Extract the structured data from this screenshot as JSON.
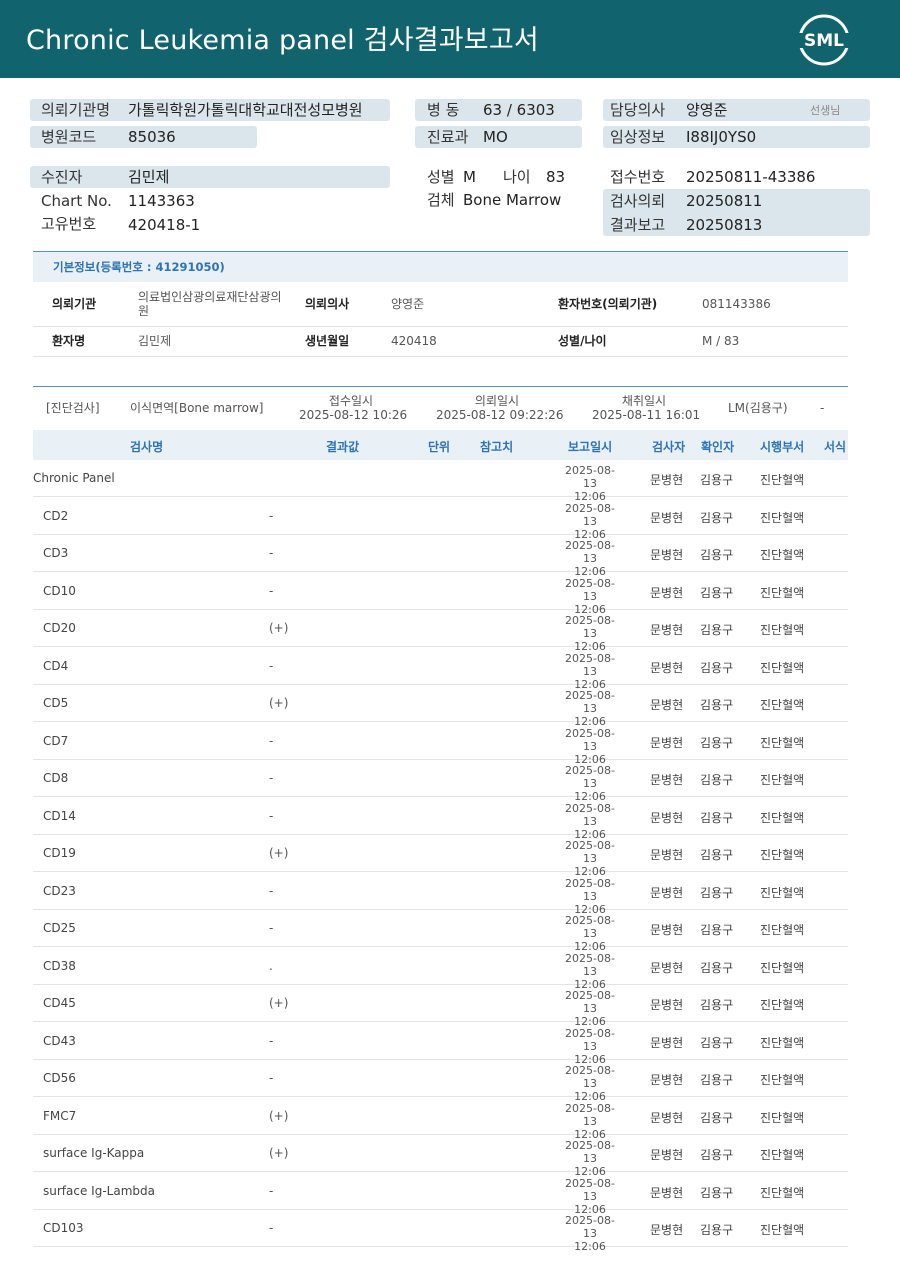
{
  "header": {
    "title": "Chronic  Leukemia  panel 검사결과보고서",
    "logo_text": "SML",
    "brand_color": "#11636d"
  },
  "patient": {
    "institution_label": "의뢰기관명",
    "institution_value": "가톨릭학원가톨릭대학교대전성모병원",
    "hospital_code_label": "병원코드",
    "hospital_code_value": "85036",
    "ward_label": "병  동",
    "ward_value": "63 / 6303",
    "dept_label": "진료과",
    "dept_value": "MO",
    "doctor_label": "담당의사",
    "doctor_value": "양영준",
    "doctor_suffix": "선생님",
    "clinical_label": "임상정보",
    "clinical_value": "I88IJ0YS0",
    "patient_label": "수진자",
    "patient_value": "김민제",
    "chart_label": "Chart No.",
    "chart_value": "1143363",
    "unique_label": "고유번호",
    "unique_value": "420418-1",
    "sex_label": "성별",
    "sex_value": "M",
    "age_label": "나이",
    "age_value": "83",
    "specimen_label": "검체",
    "specimen_value": "Bone Marrow",
    "receipt_label": "접수번호",
    "receipt_value": "20250811-43386",
    "request_label": "검사의뢰",
    "request_value": "20250811",
    "report_label": "결과보고",
    "report_value": "20250813"
  },
  "basic": {
    "heading": "기본정보(등록번호 : 41291050)",
    "inst_label": "의뢰기관",
    "inst_value_1": "의료법인삼광의료재단삼광의",
    "inst_value_2": "원",
    "doctor_label": "의뢰의사",
    "doctor_value": "양영준",
    "pid_label": "환자번호(의뢰기관)",
    "pid_value": "081143386",
    "name_label": "환자명",
    "name_value": "김민제",
    "dob_label": "생년월일",
    "dob_value": "420418",
    "sexage_label": "성별/나이",
    "sexage_value": "M / 83"
  },
  "test": {
    "category": "[진단검사]",
    "specimen": "이식면역[Bone marrow]",
    "receipt_label": "접수일시",
    "receipt_value": "2025-08-12 10:26",
    "request_label": "의뢰일시",
    "request_value": "2025-08-12 09:22:26",
    "collect_label": "채취일시",
    "collect_value": "2025-08-11 16:01",
    "lm": "LM(김용구)",
    "dash": "-",
    "columns": [
      "검사명",
      "결과값",
      "단위",
      "참고치",
      "보고일시",
      "검사자",
      "확인자",
      "시행부서",
      "서식"
    ],
    "rows": [
      {
        "name": "Chronic Panel",
        "result": "",
        "date": "2025-08-13",
        "time": "12:06",
        "tester": "문병현",
        "confirmer": "김용구",
        "dept": "진단혈액",
        "indent": false
      },
      {
        "name": "CD2",
        "result": "-",
        "date": "2025-08-13",
        "time": "12:06",
        "tester": "문병현",
        "confirmer": "김용구",
        "dept": "진단혈액",
        "indent": true
      },
      {
        "name": "CD3",
        "result": "-",
        "date": "2025-08-13",
        "time": "12:06",
        "tester": "문병현",
        "confirmer": "김용구",
        "dept": "진단혈액",
        "indent": true
      },
      {
        "name": "CD10",
        "result": "-",
        "date": "2025-08-13",
        "time": "12:06",
        "tester": "문병현",
        "confirmer": "김용구",
        "dept": "진단혈액",
        "indent": true
      },
      {
        "name": "CD20",
        "result": "(+)",
        "date": "2025-08-13",
        "time": "12:06",
        "tester": "문병현",
        "confirmer": "김용구",
        "dept": "진단혈액",
        "indent": true
      },
      {
        "name": "CD4",
        "result": "-",
        "date": "2025-08-13",
        "time": "12:06",
        "tester": "문병현",
        "confirmer": "김용구",
        "dept": "진단혈액",
        "indent": true
      },
      {
        "name": "CD5",
        "result": "(+)",
        "date": "2025-08-13",
        "time": "12:06",
        "tester": "문병현",
        "confirmer": "김용구",
        "dept": "진단혈액",
        "indent": true
      },
      {
        "name": "CD7",
        "result": "-",
        "date": "2025-08-13",
        "time": "12:06",
        "tester": "문병현",
        "confirmer": "김용구",
        "dept": "진단혈액",
        "indent": true
      },
      {
        "name": "CD8",
        "result": "-",
        "date": "2025-08-13",
        "time": "12:06",
        "tester": "문병현",
        "confirmer": "김용구",
        "dept": "진단혈액",
        "indent": true
      },
      {
        "name": "CD14",
        "result": "-",
        "date": "2025-08-13",
        "time": "12:06",
        "tester": "문병현",
        "confirmer": "김용구",
        "dept": "진단혈액",
        "indent": true
      },
      {
        "name": "CD19",
        "result": "(+)",
        "date": "2025-08-13",
        "time": "12:06",
        "tester": "문병현",
        "confirmer": "김용구",
        "dept": "진단혈액",
        "indent": true
      },
      {
        "name": "CD23",
        "result": "-",
        "date": "2025-08-13",
        "time": "12:06",
        "tester": "문병현",
        "confirmer": "김용구",
        "dept": "진단혈액",
        "indent": true
      },
      {
        "name": "CD25",
        "result": "-",
        "date": "2025-08-13",
        "time": "12:06",
        "tester": "문병현",
        "confirmer": "김용구",
        "dept": "진단혈액",
        "indent": true
      },
      {
        "name": "CD38",
        "result": ".",
        "date": "2025-08-13",
        "time": "12:06",
        "tester": "문병현",
        "confirmer": "김용구",
        "dept": "진단혈액",
        "indent": true
      },
      {
        "name": "CD45",
        "result": "(+)",
        "date": "2025-08-13",
        "time": "12:06",
        "tester": "문병현",
        "confirmer": "김용구",
        "dept": "진단혈액",
        "indent": true
      },
      {
        "name": "CD43",
        "result": "-",
        "date": "2025-08-13",
        "time": "12:06",
        "tester": "문병현",
        "confirmer": "김용구",
        "dept": "진단혈액",
        "indent": true
      },
      {
        "name": "CD56",
        "result": "-",
        "date": "2025-08-13",
        "time": "12:06",
        "tester": "문병현",
        "confirmer": "김용구",
        "dept": "진단혈액",
        "indent": true
      },
      {
        "name": "FMC7",
        "result": "(+)",
        "date": "2025-08-13",
        "time": "12:06",
        "tester": "문병현",
        "confirmer": "김용구",
        "dept": "진단혈액",
        "indent": true
      },
      {
        "name": "surface Ig-Kappa",
        "result": "(+)",
        "date": "2025-08-13",
        "time": "12:06",
        "tester": "문병현",
        "confirmer": "김용구",
        "dept": "진단혈액",
        "indent": true
      },
      {
        "name": "surface Ig-Lambda",
        "result": "-",
        "date": "2025-08-13",
        "time": "12:06",
        "tester": "문병현",
        "confirmer": "김용구",
        "dept": "진단혈액",
        "indent": true
      },
      {
        "name": "CD103",
        "result": "-",
        "date": "2025-08-13",
        "time": "12:06",
        "tester": "문병현",
        "confirmer": "김용구",
        "dept": "진단혈액",
        "indent": true
      }
    ]
  }
}
